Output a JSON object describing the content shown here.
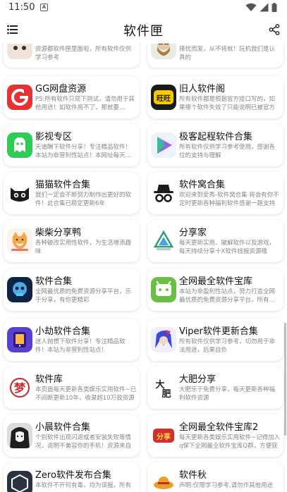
{
  "status_bar": {
    "time": "11:50",
    "notification_letter": "A"
  },
  "app_bar": {
    "title": "软件匣"
  },
  "partial_top": [
    {
      "desc_line2": "学习参考"
    },
    {
      "desc_line1": "择优而发，从不将就！玩机我们是认真的"
    }
  ],
  "partial_top_left_desc": "资源都软件匣里面啦，所有软件仅供学习参考",
  "cards": [
    {
      "title": "GG网盘资源",
      "desc": "PS:所有软件只现下测试，请勿用于其他用途！如软件用不了，那就要…",
      "icon": "gg-logo-icon",
      "color": "#e53935"
    },
    {
      "title": "旧人软件阁",
      "desc": "所有软件都是根据官方接口写的，如果哪个软件失效了只能说明已被官方修复！",
      "icon": "wang-yellow-icon",
      "color": "#f2c200"
    },
    {
      "title": "影视专区",
      "desc": "天道酬下软件分享！专注精品软件！本站为非营利性站点！本网址每天…",
      "icon": "ghost-icon",
      "color": "#2ecc55"
    },
    {
      "title": "极客起程软件合集",
      "desc": "所有软件仅供学习参考使用，感谢各位的支持与理解",
      "icon": "play-triangle-icon",
      "color": "#7c6cf0"
    },
    {
      "title": "猫猫软件合集",
      "desc": "我们一定会不断努力制作出更好的软件！此合集已稳定更新6年",
      "icon": "black-cat-icon",
      "color": "#222222"
    },
    {
      "title": "软件窝合集",
      "desc": "欢迎来到爱秀-软件窝合集 将会有你不定时更新各种福利软件感谢一路支持",
      "icon": "spy-hat-icon",
      "color": "#222222"
    },
    {
      "title": "柴柴分享鸭",
      "desc": "各种破改实用性软件，为生活增添趣味",
      "icon": "shiba-icon",
      "color": "#f3a64a"
    },
    {
      "title": "分享家",
      "desc": "每天更新实用、破解软件以及游戏，每天持续分享十X软件线报资源哦",
      "icon": "triangle-logo-icon",
      "color": "#2e9e6b"
    },
    {
      "title": "软件合集",
      "desc": "全网最优质的免费资源分享平台，乐于分享，有你更精彩",
      "icon": "glow-skull-icon",
      "color": "#1b3a6b"
    },
    {
      "title": "全网最全软件宝库",
      "desc": "本站为非盈利性站点，努力打造全网最优质的免费资源分享平台，所有…",
      "icon": "android-icon",
      "color": "#6bbf44"
    },
    {
      "title": "小劫软件合集",
      "desc": "迷人抛惯下软件分享！专注精品软件！本站为非营利性站点！",
      "icon": "tablet-icon",
      "color": "#5b3fd3"
    },
    {
      "title": "Viper软件更新合集",
      "desc": "所有软件仅供学习参考，切勿用于非法用途，后果自负",
      "icon": "anime-avatar-icon",
      "color": "#3b4bd1"
    },
    {
      "title": "软件库",
      "desc": "本页面每天更新各类娱乐实用软件~已不间断更新10年，收录超10万款资源",
      "icon": "calligraphy-icon",
      "color": "#c62828"
    },
    {
      "title": "大肥分享",
      "desc": "大肥乐于免费分享，每天更新各种福利软件资源",
      "icon": "dafei-ink-icon",
      "color": "#333333"
    },
    {
      "title": "小晨软件合集",
      "desc": "个别软件出现闪退或者安装失败等情况，说明不兼容你的手机！资源来自网络",
      "icon": "dark-girl-icon",
      "color": "#333333"
    },
    {
      "title": "全网最全软件宝库2",
      "desc": "每天更新各类娱乐实用软件~记得加入q保下全网最全软件宝库Q群，方便获取…",
      "icon": "fenxiang-red-icon",
      "color": "#d32f2f"
    },
    {
      "title": "Zero软件发布合集",
      "desc": "本软件不开何有毒，均为误报。所有",
      "icon": "zero-icon",
      "color": "#2a3140"
    },
    {
      "title": "软件秋",
      "desc": "声明:仅限学习参考,请勿作其他用途",
      "icon": "cartoon-hat-icon",
      "color": "#e7a12f"
    }
  ]
}
